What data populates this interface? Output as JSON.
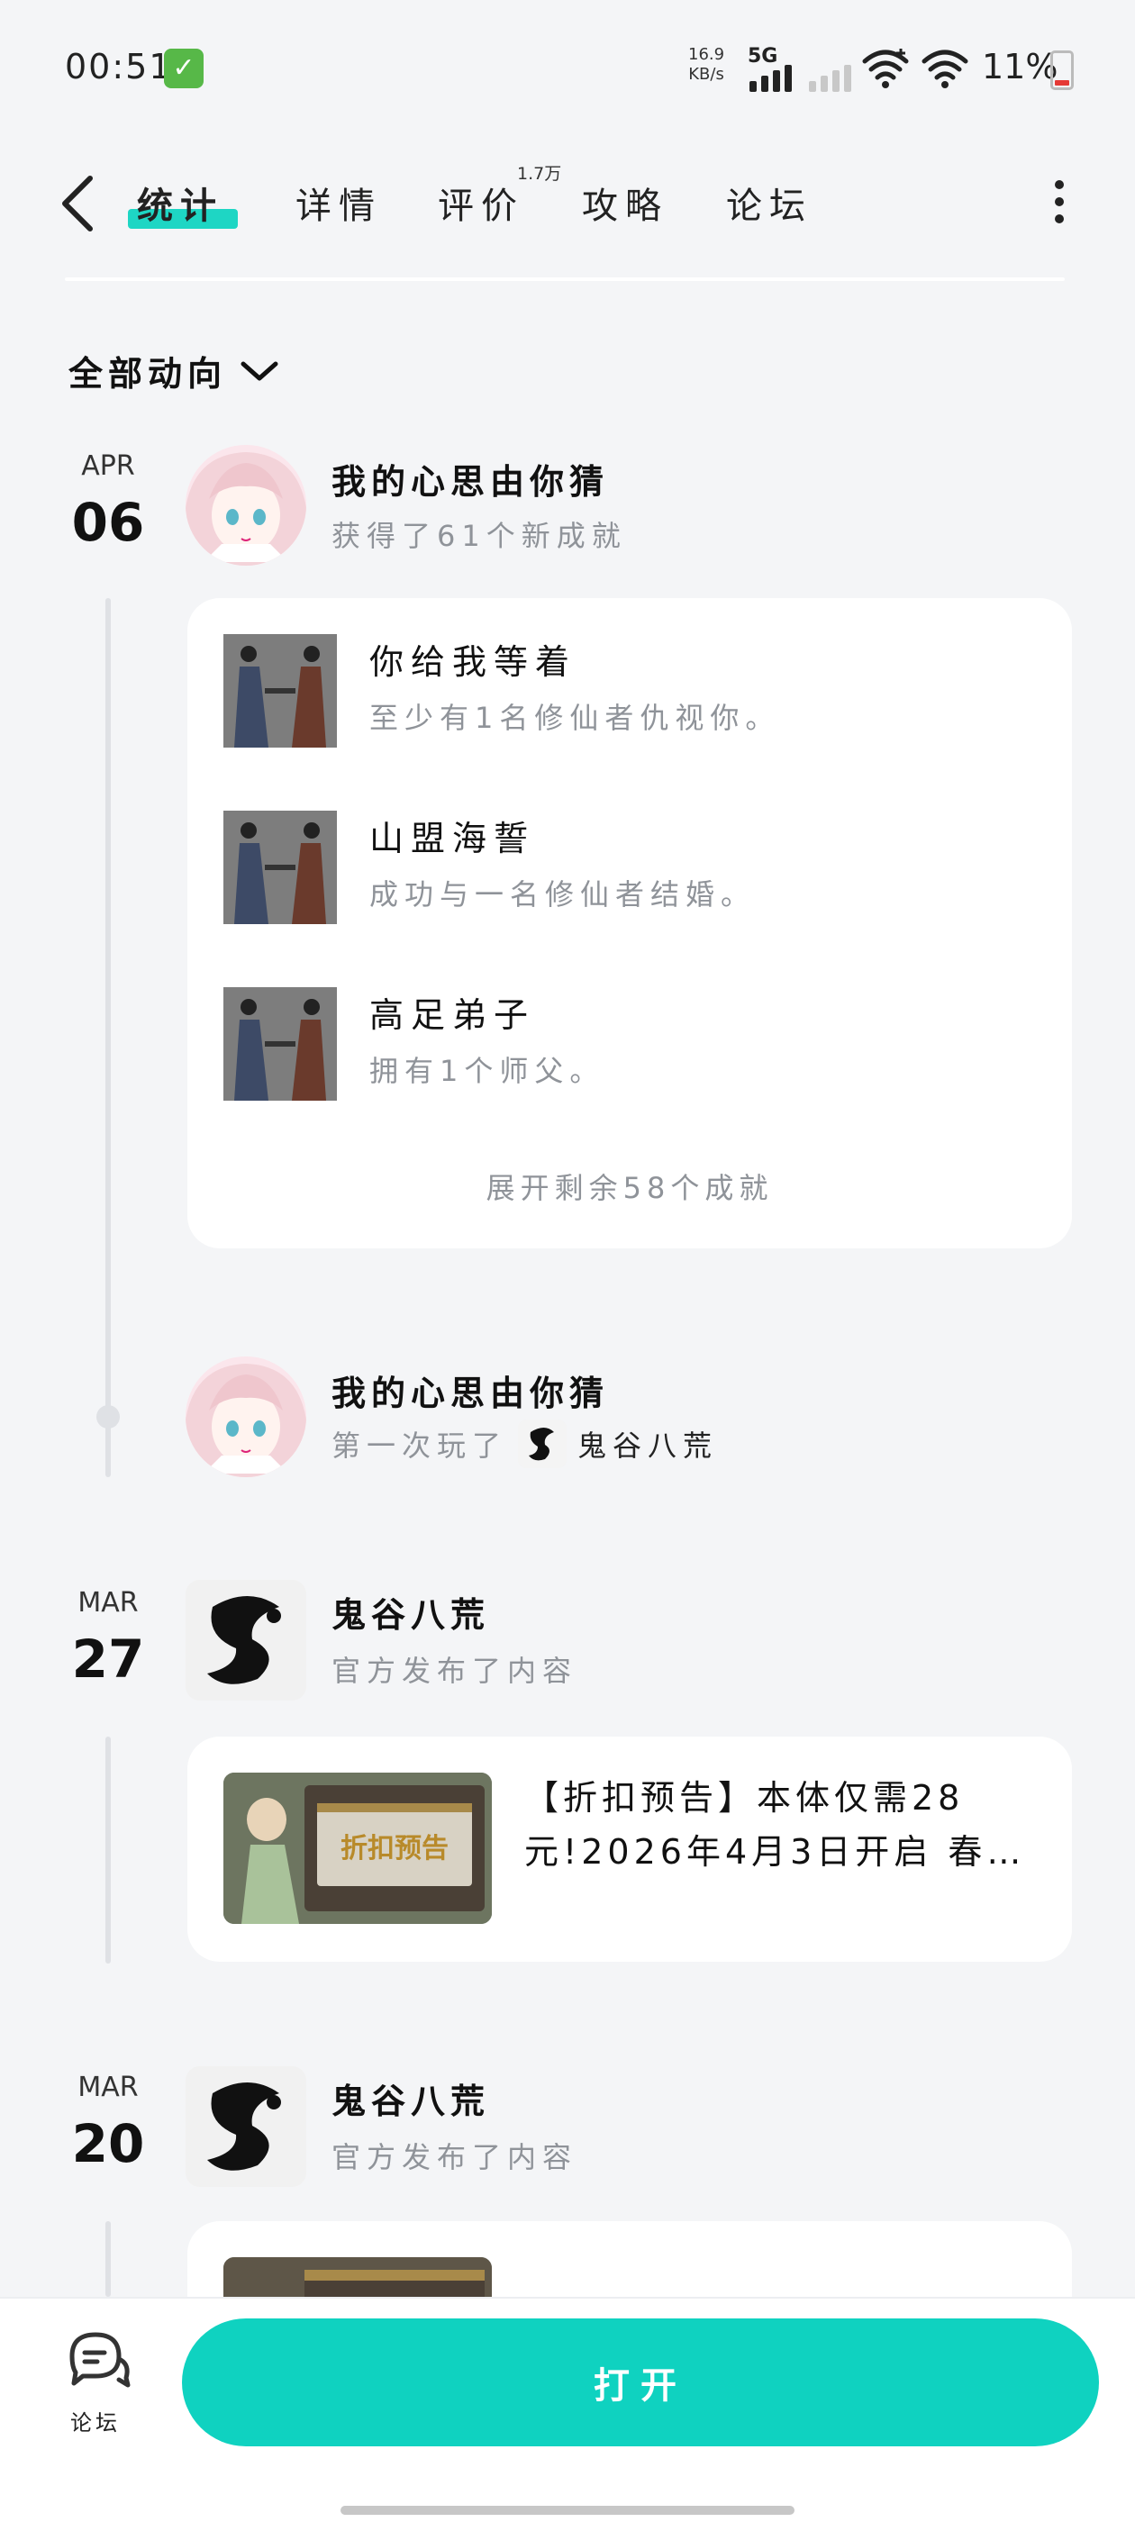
{
  "status_bar": {
    "time": "00:51",
    "net_speed_value": "16.9",
    "net_speed_unit": "KB/s",
    "network": "5G",
    "battery": "11%"
  },
  "header": {
    "tabs": [
      {
        "label": "统计",
        "active": true
      },
      {
        "label": "详情",
        "active": false
      },
      {
        "label": "评价",
        "active": false,
        "badge": "1.7万"
      },
      {
        "label": "攻略",
        "active": false
      },
      {
        "label": "论坛",
        "active": false
      }
    ]
  },
  "filter": {
    "label": "全部动向"
  },
  "timeline": [
    {
      "month": "APR",
      "day": "06",
      "user": "我的心思由你猜",
      "action": "获得了61个新成就",
      "achievements": [
        {
          "title": "你给我等着",
          "desc": "至少有1名修仙者仇视你。"
        },
        {
          "title": "山盟海誓",
          "desc": "成功与一名修仙者结婚。"
        },
        {
          "title": "高足弟子",
          "desc": "拥有1个师父。"
        }
      ],
      "expand": "展开剩余58个成就"
    },
    {
      "user": "我的心思由你猜",
      "action": "第一次玩了",
      "game": "鬼谷八荒"
    },
    {
      "month": "MAR",
      "day": "27",
      "user": "鬼谷八荒",
      "action": "官方发布了内容",
      "post_image_text": "折扣预告",
      "post_text": "【折扣预告】本体仅需28元!2026年4月3日开启 春…"
    },
    {
      "month": "MAR",
      "day": "20",
      "user": "鬼谷八荒",
      "action": "官方发布了内容"
    }
  ],
  "bottom_bar": {
    "forum_label": "论坛",
    "open_button": "打开"
  },
  "colors": {
    "accent": "#0fd2c0",
    "tab_underline": "#1ed6c4",
    "background": "#f4f5f7",
    "muted_text": "#8f9399"
  }
}
